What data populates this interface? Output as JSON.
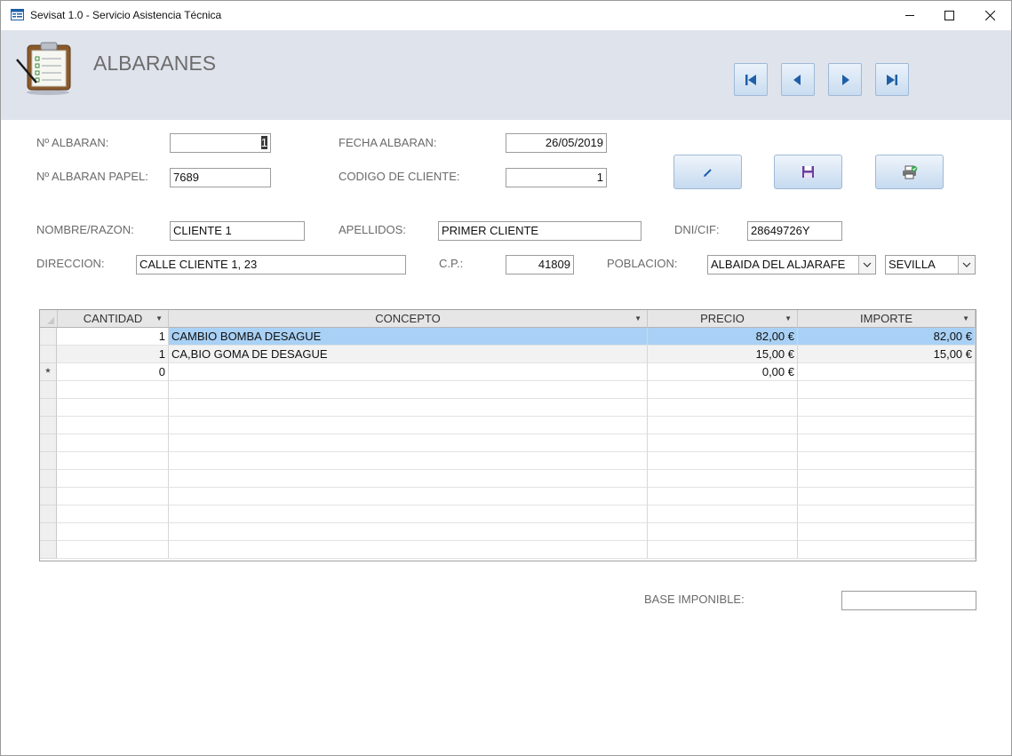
{
  "window": {
    "title": "Sevisat 1.0 - Servicio Asistencia Técnica"
  },
  "header": {
    "title": "ALBARANES"
  },
  "form": {
    "n_albaran": {
      "label": "Nº ALBARAN:",
      "value": "1"
    },
    "fecha_albaran": {
      "label": "FECHA ALBARAN:",
      "value": "26/05/2019"
    },
    "n_albaran_papel": {
      "label": "Nº ALBARAN PAPEL:",
      "value": "7689"
    },
    "codigo_cliente": {
      "label": "CODIGO DE CLIENTE:",
      "value": "1"
    },
    "nombre": {
      "label": "NOMBRE/RAZON:",
      "value": "CLIENTE 1"
    },
    "apellidos": {
      "label": "APELLIDOS:",
      "value": "PRIMER CLIENTE"
    },
    "dni": {
      "label": "DNI/CIF:",
      "value": "28649726Y"
    },
    "direccion": {
      "label": "DIRECCION:",
      "value": "CALLE CLIENTE 1, 23"
    },
    "cp": {
      "label": "C.P.:",
      "value": "41809"
    },
    "poblacion": {
      "label": "POBLACION:",
      "value": "ALBAIDA DEL ALJARAFE"
    },
    "provincia": {
      "value": "SEVILLA"
    }
  },
  "grid": {
    "columns": [
      "CANTIDAD",
      "CONCEPTO",
      "PRECIO",
      "IMPORTE"
    ],
    "rows": [
      {
        "cantidad": "1",
        "concepto": "CAMBIO BOMBA DESAGUE",
        "precio": "82,00 €",
        "importe": "82,00 €"
      },
      {
        "cantidad": "1",
        "concepto": "CA,BIO GOMA DE DESAGUE",
        "precio": "15,00 €",
        "importe": "15,00 €"
      }
    ],
    "new_row": {
      "marker": "*",
      "cantidad": "0",
      "concepto": "",
      "precio": "0,00 €",
      "importe": ""
    }
  },
  "totals": {
    "base_label": "BASE IMPONIBLE:",
    "base_value": ""
  },
  "icons": {
    "nav": [
      "first-record-icon",
      "prev-record-icon",
      "next-record-icon",
      "last-record-icon"
    ],
    "actions": [
      "edit-icon",
      "save-icon",
      "print-icon"
    ]
  },
  "colors": {
    "header_bg": "#dfe3ec",
    "selected_row": "#a9d1f5",
    "nav_icon": "#1f5fa8",
    "button_border": "#9fb9d6"
  }
}
